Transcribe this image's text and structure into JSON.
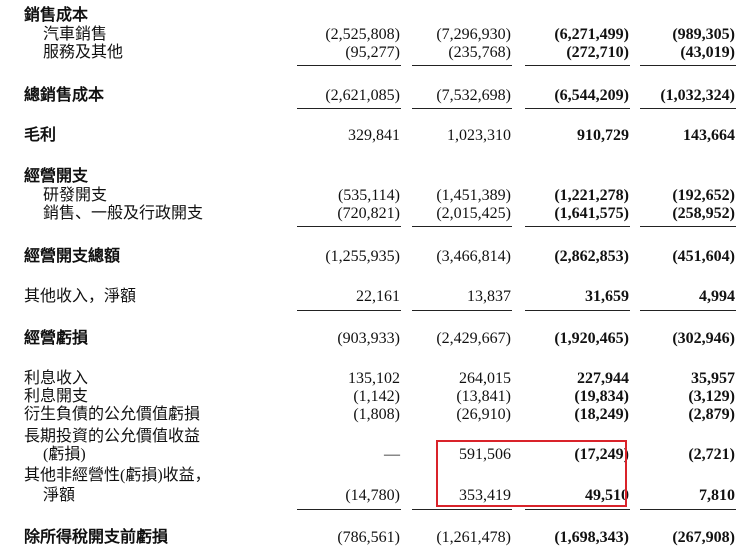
{
  "rows": [
    {
      "label": "銷售成本",
      "style": "header"
    },
    {
      "label": "汽車銷售",
      "style": "sub",
      "v": [
        "(2,525,808)",
        "(7,296,930)",
        "(6,271,499)",
        "(989,305)"
      ]
    },
    {
      "label": "服務及其他",
      "style": "sub",
      "v": [
        "(95,277)",
        "(235,768)",
        "(272,710)",
        "(43,019)"
      ]
    },
    {
      "label": "總銷售成本",
      "style": "bold",
      "v": [
        "(2,621,085)",
        "(7,532,698)",
        "(6,544,209)",
        "(1,032,324)"
      ]
    },
    {
      "label": "毛利",
      "style": "bold",
      "v": [
        "329,841",
        "1,023,310",
        "910,729",
        "143,664"
      ]
    },
    {
      "label": "經營開支",
      "style": "header"
    },
    {
      "label": "研發開支",
      "style": "sub",
      "v": [
        "(535,114)",
        "(1,451,389)",
        "(1,221,278)",
        "(192,652)"
      ]
    },
    {
      "label": "銷售、一般及行政開支",
      "style": "sub",
      "v": [
        "(720,821)",
        "(2,015,425)",
        "(1,641,575)",
        "(258,952)"
      ]
    },
    {
      "label": "經營開支總額",
      "style": "bold",
      "v": [
        "(1,255,935)",
        "(3,466,814)",
        "(2,862,853)",
        "(451,604)"
      ]
    },
    {
      "label": "其他收入，淨額",
      "style": "plain",
      "v": [
        "22,161",
        "13,837",
        "31,659",
        "4,994"
      ]
    },
    {
      "label": "經營虧損",
      "style": "bold",
      "v": [
        "(903,933)",
        "(2,429,667)",
        "(1,920,465)",
        "(302,946)"
      ]
    },
    {
      "label": "利息收入",
      "style": "plain",
      "v": [
        "135,102",
        "264,015",
        "227,944",
        "35,957"
      ]
    },
    {
      "label": "利息開支",
      "style": "plain",
      "v": [
        "(1,142)",
        "(13,841)",
        "(19,834)",
        "(3,129)"
      ]
    },
    {
      "label": "衍生負債的公允價值虧損",
      "style": "plain",
      "v": [
        "(1,808)",
        "(26,910)",
        "(18,249)",
        "(2,879)"
      ]
    },
    {
      "label": "長期投資的公允價值收益",
      "style": "plain"
    },
    {
      "label": "(虧損)",
      "style": "cont",
      "v": [
        "—",
        "591,506",
        "(17,249)",
        "(2,721)"
      ]
    },
    {
      "label": "其他非經營性(虧損)收益，",
      "style": "plain"
    },
    {
      "label": "淨額",
      "style": "cont",
      "v": [
        "(14,780)",
        "353,419",
        "49,510",
        "7,810"
      ]
    },
    {
      "label": "除所得稅開支前虧損",
      "style": "bold",
      "v": [
        "(786,561)",
        "(1,261,478)",
        "(1,698,343)",
        "(267,908)"
      ]
    }
  ]
}
